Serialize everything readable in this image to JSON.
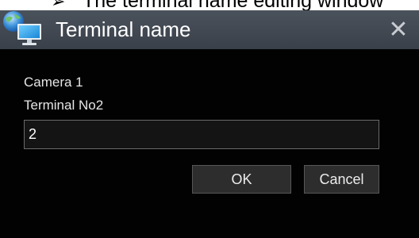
{
  "caption": {
    "bullet": "➢",
    "text": "The terminal name editing window"
  },
  "dialog": {
    "title": "Terminal name",
    "close_label": "✕",
    "camera_label": "Camera 1",
    "terminal_label": "Terminal No2",
    "name_value": "2",
    "ok_label": "OK",
    "cancel_label": "Cancel"
  },
  "icons": {
    "app": "monitor-globe-icon",
    "close": "close-icon"
  },
  "colors": {
    "titlebar": "#3f464f",
    "body": "#020202",
    "text": "#e6e6e6",
    "button": "#2d2d2d"
  }
}
